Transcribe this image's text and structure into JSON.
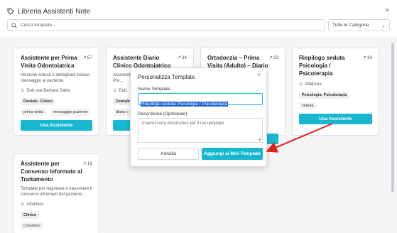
{
  "header": {
    "title": "Libreria Assistenti Note",
    "close": "×"
  },
  "search": {
    "placeholder": "Cerca template..."
  },
  "filter": {
    "selected": "Tutte le Categorie"
  },
  "cards": [
    {
      "title": "Assistente per Prima Visita Odontoiatrica",
      "uses": "57",
      "desc": "Versione estesa e dettagliata incluso messaggio al paziente.",
      "author": "Dott.ssa Barbara Sabiu",
      "category": "Dentale, Clinico",
      "tags": [
        "prima visita",
        "messaggio paziente"
      ],
      "button": "Usa Assistente"
    },
    {
      "title": "Assistente Diario Clinico Odontoiatrico",
      "uses": "34",
      "desc": "Assistente per la compilazione delle Pre...",
      "author": "Dott.",
      "category": "Dentale",
      "tags": [
        "diario c"
      ],
      "button": "Usa Assistente"
    },
    {
      "title": "Ortodonzia – Prima Visita (Adulto) – Diario clinico",
      "uses": "23",
      "button": "Usa Assistente"
    },
    {
      "title": "Riepilogo seduta Psicologia / Psicoterapia",
      "uses": "19",
      "author": "AlfaDocs",
      "category": "Psicologia, Psicoterapia",
      "tags": [
        "seduta"
      ],
      "button": "Usa Assistente"
    },
    {
      "title": "Assistente per Consenso Informato al Trattamento",
      "uses": "19",
      "desc": "Template per registrare e trascrivere il consenso informato del paziente ...",
      "author": "AlfaDocs",
      "category": "Clinico",
      "tags": [
        "consenso"
      ]
    }
  ],
  "modal": {
    "title": "Personalizza Template",
    "close": "×",
    "name_label": "Nome Template",
    "name_value": "Riepilogo seduta Psicologia / Psicoterapia",
    "desc_label": "Descrizione (Opzionale)",
    "desc_placeholder": "Inserisci una descrizione per il tuo template",
    "cancel": "Annulla",
    "confirm": "Aggiungi ai Miei Template"
  },
  "colors": {
    "accent": "#17b7cf",
    "arrow": "#e02020",
    "selection": "#1e62d0"
  }
}
